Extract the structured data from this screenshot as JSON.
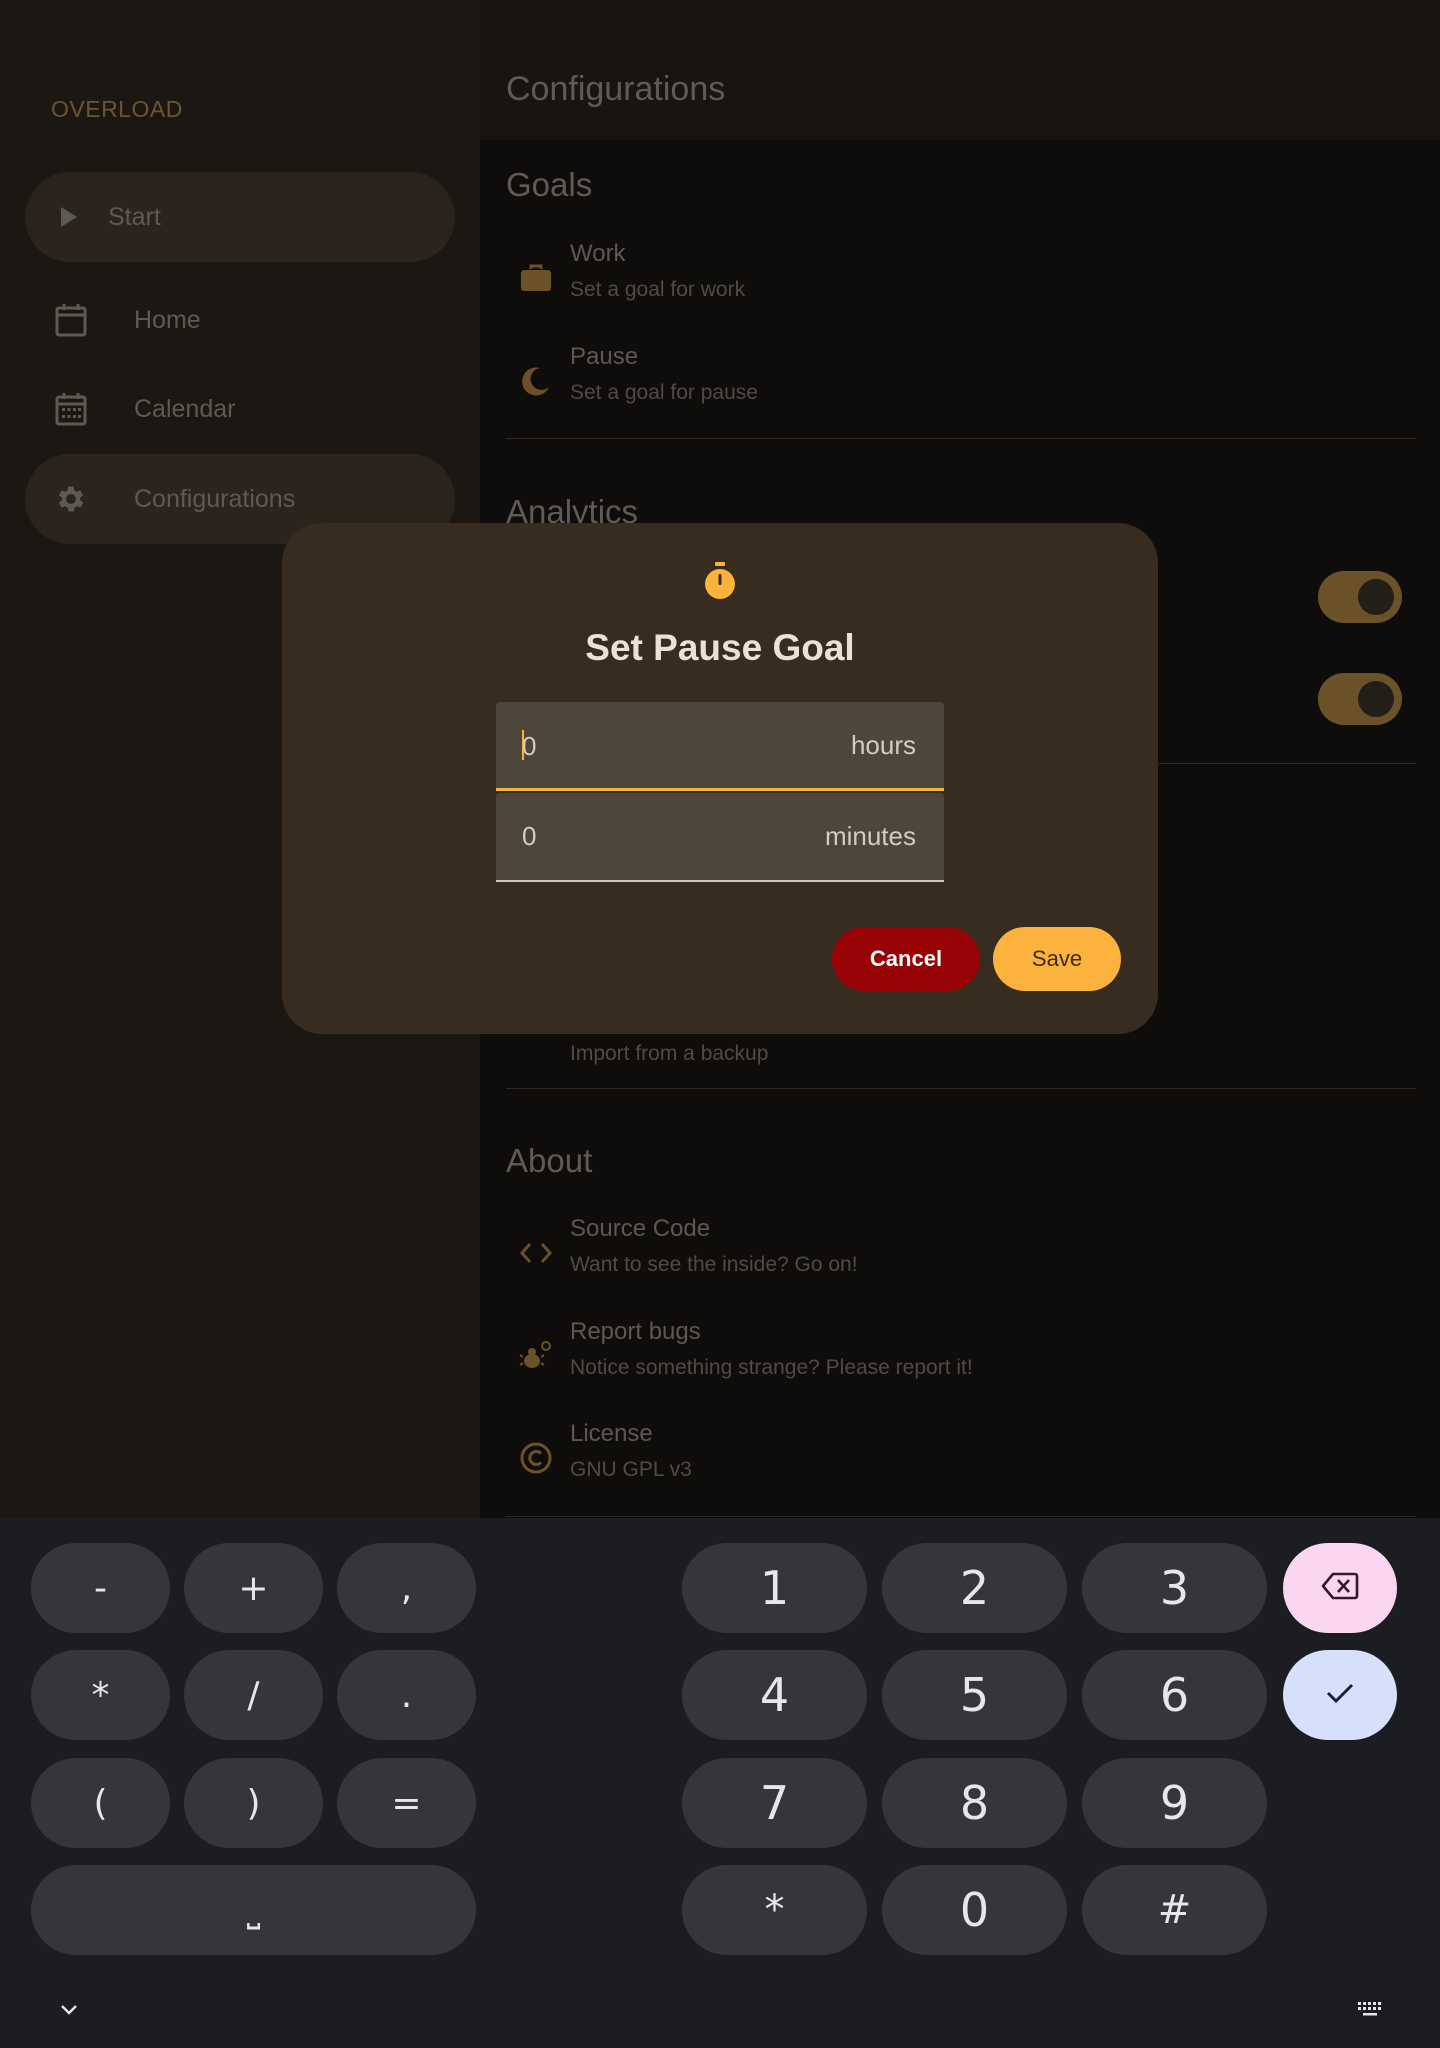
{
  "app": {
    "name": "OVERLOAD"
  },
  "nav": {
    "start": "Start",
    "items": [
      {
        "label": "Home",
        "icon": "calendar-blank-icon"
      },
      {
        "label": "Calendar",
        "icon": "calendar-month-icon"
      },
      {
        "label": "Configurations",
        "icon": "gear-icon"
      }
    ]
  },
  "page": {
    "title": "Configurations"
  },
  "sections": {
    "goals": {
      "title": "Goals",
      "work": {
        "title": "Work",
        "subtitle": "Set a goal for work",
        "icon": "briefcase-icon"
      },
      "pause": {
        "title": "Pause",
        "subtitle": "Set a goal for pause",
        "icon": "moon-icon"
      }
    },
    "analytics": {
      "title": "Analytics"
    },
    "backup": {
      "import_subtitle": "Import from a backup"
    },
    "about": {
      "title": "About",
      "source": {
        "title": "Source Code",
        "subtitle": "Want to see the inside? Go on!",
        "icon": "code-icon"
      },
      "bugs": {
        "title": "Report bugs",
        "subtitle": "Notice something strange? Please report it!",
        "icon": "bug-icon"
      },
      "license": {
        "title": "License",
        "subtitle": "GNU GPL v3",
        "icon": "copyright-icon"
      }
    }
  },
  "dialog": {
    "icon": "stopwatch-icon",
    "title": "Set Pause Goal",
    "hours": {
      "value": "0",
      "suffix": "hours"
    },
    "minutes": {
      "value": "0",
      "suffix": "minutes"
    },
    "cancel": "Cancel",
    "save": "Save"
  },
  "keyboard": {
    "symbols": [
      "-",
      "+",
      ",",
      "*",
      "/",
      ".",
      "(",
      ")",
      "="
    ],
    "digits": [
      "1",
      "2",
      "3",
      "4",
      "5",
      "6",
      "7",
      "8",
      "9",
      "*",
      "0",
      "#"
    ],
    "space_glyph": "⎵"
  },
  "colors": {
    "accent": "#fbb33d",
    "cancel": "#980306",
    "dialog_bg": "#372c1f",
    "keyboard_bg": "#1b1d21"
  }
}
